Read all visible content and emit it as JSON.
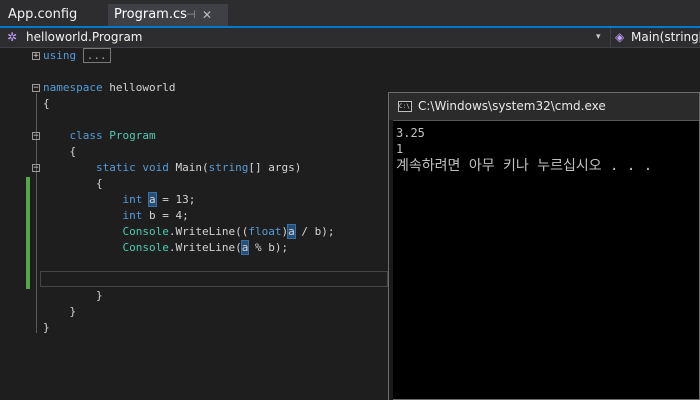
{
  "tabs": {
    "inactive": "App.config",
    "active": "Program.cs",
    "pin_glyph": "⊣",
    "close_glyph": "✕"
  },
  "navbar": {
    "type_label": "helloworld.Program",
    "member_label": "Main(string[]"
  },
  "code": {
    "using_kw": "using",
    "using_collapsed": "...",
    "namespace_kw": "namespace",
    "namespace_name": "helloworld",
    "brace_open": "{",
    "brace_close": "}",
    "class_kw": "class",
    "class_name": "Program",
    "static_kw": "static",
    "void_kw": "void",
    "main_name": "Main(",
    "string_kw": "string",
    "main_params": "[] args)",
    "int_kw": "int",
    "var_a": "a",
    "assign_a": " = 13;",
    "decl_b": " b = 4;",
    "console": "Console",
    "writeline_1_pre": ".WriteLine((",
    "float_kw": "float",
    "writeline_1_post": " / b);",
    "writeline_2_pre": ".WriteLine(",
    "writeline_2_post": " % b);"
  },
  "cmd": {
    "title": "C:\\Windows\\system32\\cmd.exe",
    "icon_text": "C:\\",
    "lines": [
      "3.25",
      "1",
      "계속하려면 아무 키나 누르십시오 . . ."
    ]
  },
  "colors": {
    "keyword": "#569cd6",
    "type": "#4ec9b0",
    "change_bar": "#57a64a",
    "highlight": "#264f78",
    "tab_accent": "#007acc"
  }
}
